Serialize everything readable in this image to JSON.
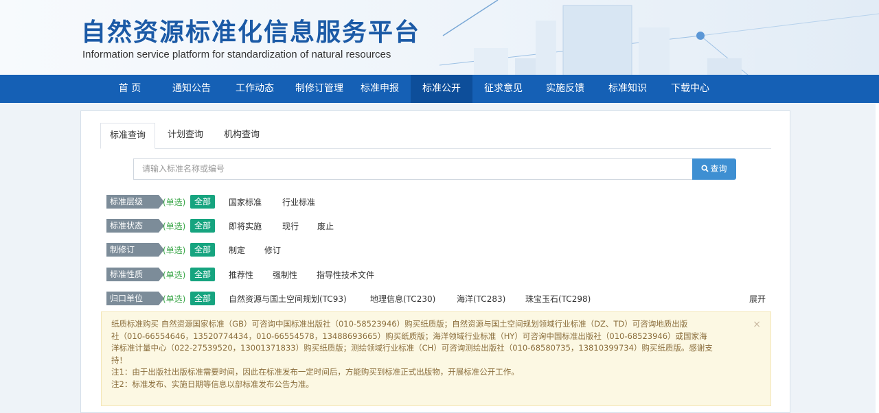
{
  "header": {
    "title": "自然资源标准化信息服务平台",
    "subtitle": "Information service platform for standardization of natural resources"
  },
  "nav": {
    "items": [
      "首 页",
      "通知公告",
      "工作动态",
      "制修订管理",
      "标准申报",
      "标准公开",
      "征求意见",
      "实施反馈",
      "标准知识",
      "下载中心"
    ],
    "active": "标准公开"
  },
  "tabs": {
    "items": [
      "标准查询",
      "计划查询",
      "机构查询"
    ],
    "active": "标准查询"
  },
  "search": {
    "placeholder": "请输入标准名称或编号",
    "button_label": "查询"
  },
  "filters": [
    {
      "label": "标准层级",
      "hint": "(单选)",
      "all": "全部",
      "options": [
        "国家标准",
        "行业标准"
      ]
    },
    {
      "label": "标准状态",
      "hint": "(单选)",
      "all": "全部",
      "options": [
        "即将实施",
        "现行",
        "废止"
      ]
    },
    {
      "label": "制修订",
      "hint": "(单选)",
      "all": "全部",
      "options": [
        "制定",
        "修订"
      ]
    },
    {
      "label": "标准性质",
      "hint": "(单选)",
      "all": "全部",
      "options": [
        "推荐性",
        "强制性",
        "指导性技术文件"
      ]
    },
    {
      "label": "归口单位",
      "hint": "(单选)",
      "all": "全部",
      "options": [
        "自然资源与国土空间规划(TC93)",
        "地理信息(TC230)",
        "海洋(TC283)",
        "珠宝玉石(TC298)"
      ],
      "expand": "展开"
    }
  ],
  "notice": {
    "line1": "纸质标准购买 自然资源国家标准（GB）可咨询中国标准出版社（010-58523946）购买纸质版；自然资源与国土空间规划领域行业标准（DZ、TD）可咨询地质出版",
    "line2": "社（010-66554646，13520774434，010-66554578，13488693665）购买纸质版；海洋领域行业标准（HY）可咨询中国标准出版社（010-68523946）或国家海",
    "line3": "洋标准计量中心（022-27539520，13001371833）购买纸质版；测绘领域行业标准（CH）可咨询测绘出版社（010-68580735，13810399734）购买纸质版。感谢支",
    "line4": "持！",
    "note1": "注1：由于出版社出版标准需要时间，因此在标准发布一定时间后，方能购买到标准正式出版物，开展标准公开工作。",
    "note2": "注2：标准发布、实施日期等信息以部标准发布公告为准。",
    "close": "×"
  }
}
